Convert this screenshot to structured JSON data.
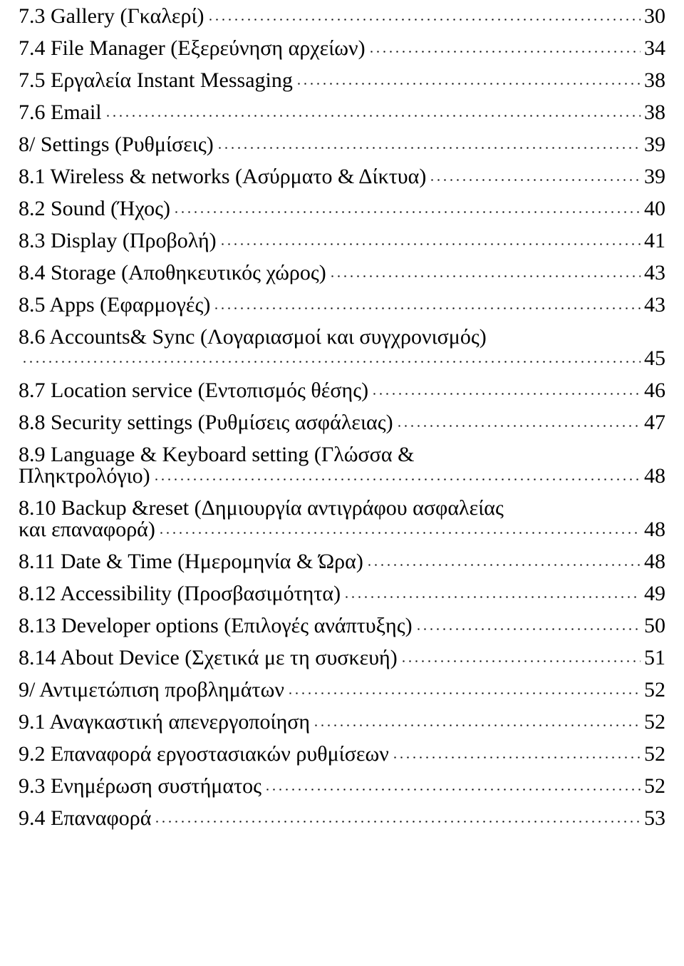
{
  "document": {
    "type": "table-of-contents",
    "entries": [
      {
        "id": "7-3",
        "label": "7.3 Gallery (Γκαλερί)",
        "page": "30",
        "wrapped": false
      },
      {
        "id": "7-4",
        "label": "7.4 File Manager (Εξερεύνηση αρχείων)",
        "page": "34",
        "wrapped": false
      },
      {
        "id": "7-5",
        "label": "7.5 Εργαλεία Instant Messaging",
        "page": "38",
        "wrapped": false
      },
      {
        "id": "7-6",
        "label": "7.6 Email",
        "page": "38",
        "wrapped": false
      },
      {
        "id": "8",
        "label": "8/ Settings (Ρυθμίσεις)",
        "page": "39",
        "wrapped": false
      },
      {
        "id": "8-1",
        "label": "8.1 Wireless & networks (Ασύρματο & Δίκτυα)",
        "page": "39",
        "wrapped": false
      },
      {
        "id": "8-2",
        "label": "8.2 Sound (Ήχος)",
        "page": "40",
        "wrapped": false
      },
      {
        "id": "8-3",
        "label": "8.3 Display (Προβολή)",
        "page": "41",
        "wrapped": false
      },
      {
        "id": "8-4",
        "label": "8.4 Storage (Αποθηκευτικός χώρος)",
        "page": "43",
        "wrapped": false
      },
      {
        "id": "8-5",
        "label": "8.5 Apps (Εφαρμογές)",
        "page": "43",
        "wrapped": false
      },
      {
        "id": "8-6",
        "label": "8.6 Accounts& Sync (Λογαριασμοί και συγχρονισμός)",
        "label_line2": "",
        "page": "45",
        "wrapped": true
      },
      {
        "id": "8-7",
        "label": "8.7 Location service (Εντοπισμός θέσης)",
        "page": "46",
        "wrapped": false
      },
      {
        "id": "8-8",
        "label": "8.8 Security settings (Ρυθμίσεις ασφάλειας)",
        "page": "47",
        "wrapped": false
      },
      {
        "id": "8-9",
        "label": "8.9 Language & Keyboard setting (Γλώσσα &",
        "label_line2": "Πληκτρολόγιο)",
        "page": "48",
        "wrapped": true
      },
      {
        "id": "8-10",
        "label": "8.10 Backup &reset (Δημιουργία αντιγράφου ασφαλείας",
        "label_line2": "και επαναφορά)",
        "page": "48",
        "wrapped": true
      },
      {
        "id": "8-11",
        "label": "8.11 Date & Time (Ημερομηνία & Ώρα)",
        "page": "48",
        "wrapped": false
      },
      {
        "id": "8-12",
        "label": "8.12 Accessibility (Προσβασιμότητα)",
        "page": "49",
        "wrapped": false
      },
      {
        "id": "8-13",
        "label": "8.13 Developer options (Επιλογές ανάπτυξης)",
        "page": "50",
        "wrapped": false
      },
      {
        "id": "8-14",
        "label": "8.14 About Device (Σχετικά με τη συσκευή)",
        "page": "51",
        "wrapped": false
      },
      {
        "id": "9",
        "label": "9/ Αντιμετώπιση προβλημάτων",
        "page": "52",
        "wrapped": false
      },
      {
        "id": "9-1",
        "label": "9.1 Αναγκαστική απενεργοποίηση",
        "page": "52",
        "wrapped": false
      },
      {
        "id": "9-2",
        "label": "9.2 Επαναφορά εργοστασιακών ρυθμίσεων",
        "page": "52",
        "wrapped": false
      },
      {
        "id": "9-3",
        "label": "9.3 Ενημέρωση συστήματος",
        "page": "52",
        "wrapped": false
      },
      {
        "id": "9-4",
        "label": "9.4 Επαναφορά",
        "page": "53",
        "wrapped": false
      }
    ]
  }
}
